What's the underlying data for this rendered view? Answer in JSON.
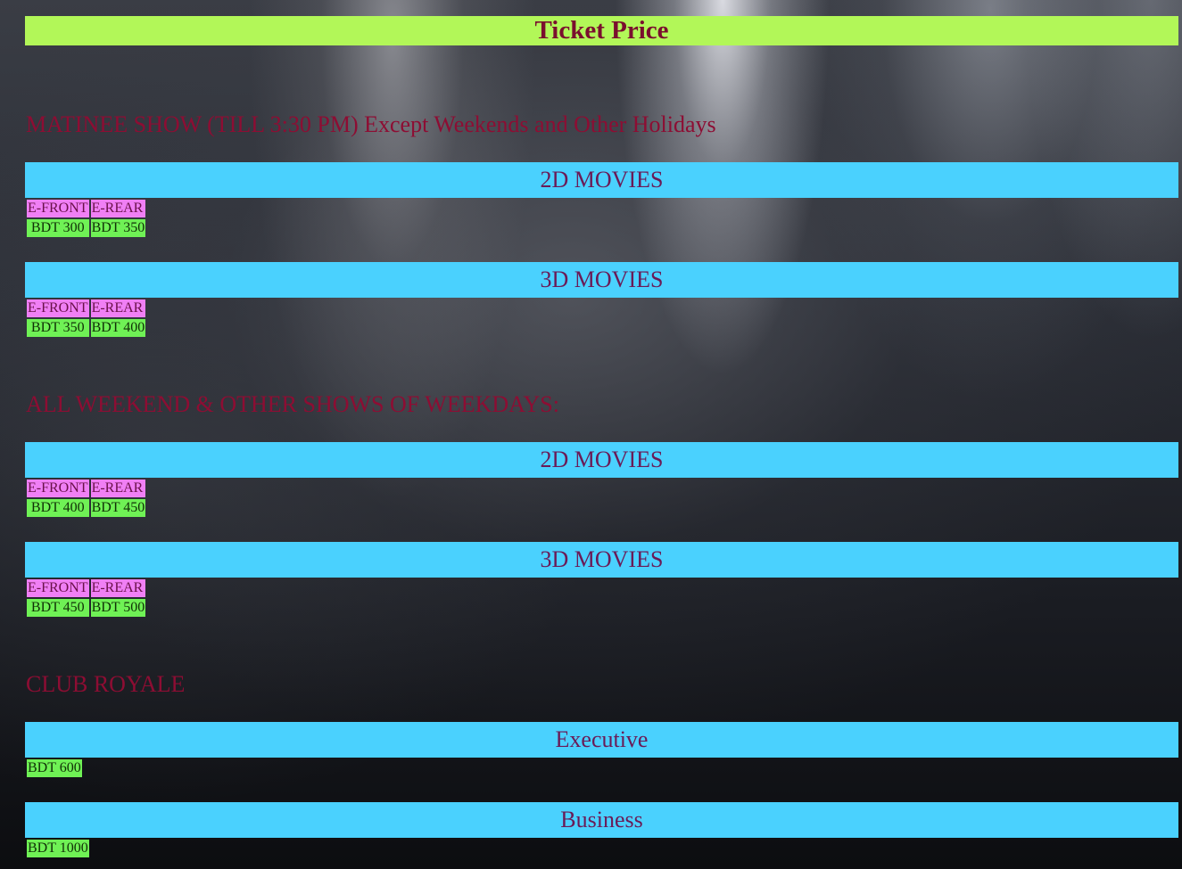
{
  "page": {
    "title": "Ticket Price"
  },
  "matinee": {
    "heading": "MATINEE SHOW (TILL 3:30 PM) Except Weekends and Other Holidays",
    "blocks": [
      {
        "label": "2D MOVIES",
        "seats": [
          "E-FRONT",
          "E-REAR"
        ],
        "prices": [
          "BDT 300",
          "BDT 350"
        ]
      },
      {
        "label": "3D MOVIES",
        "seats": [
          "E-FRONT",
          "E-REAR"
        ],
        "prices": [
          "BDT 350",
          "BDT 400"
        ]
      }
    ]
  },
  "weekend": {
    "heading": "ALL WEEKEND & OTHER SHOWS OF WEEKDAYS:",
    "blocks": [
      {
        "label": "2D MOVIES",
        "seats": [
          "E-FRONT",
          "E-REAR"
        ],
        "prices": [
          "BDT 400",
          "BDT 450"
        ]
      },
      {
        "label": "3D MOVIES",
        "seats": [
          "E-FRONT",
          "E-REAR"
        ],
        "prices": [
          "BDT 450",
          "BDT 500"
        ]
      }
    ]
  },
  "club": {
    "heading": "CLUB ROYALE",
    "blocks": [
      {
        "label": "Executive",
        "price": "BDT 600"
      },
      {
        "label": "Business",
        "price": "BDT 1000"
      }
    ]
  },
  "colors": {
    "title_bar": "#b2f758",
    "section_bar": "#4ad1fe",
    "seat_cell": "#f07ff5",
    "price_cell": "#6ff155",
    "heading_text": "#8d0d33"
  }
}
